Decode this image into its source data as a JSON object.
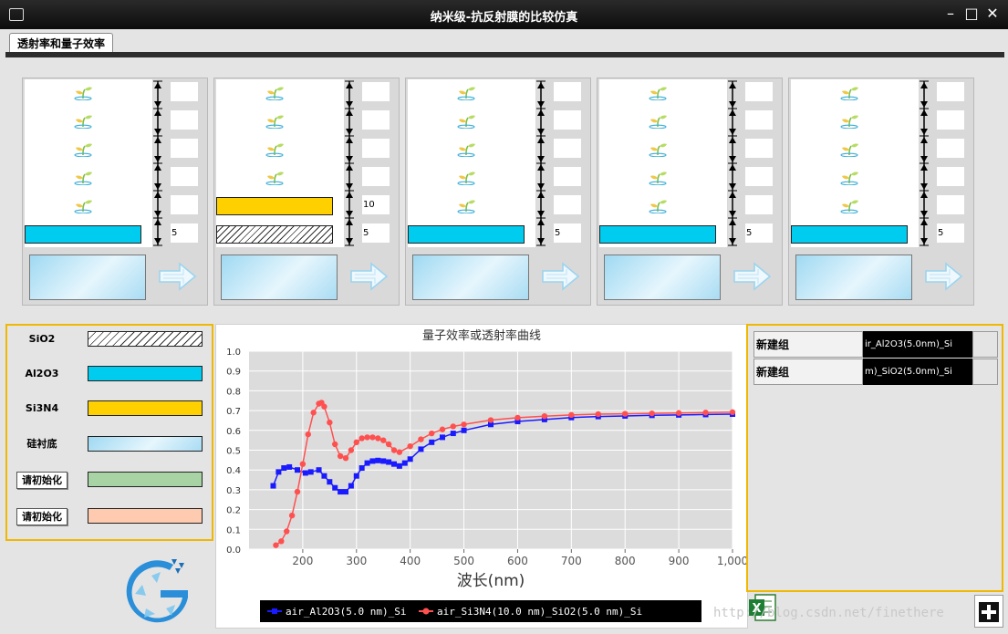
{
  "window": {
    "title": "纳米级-抗反射膜的比较仿真"
  },
  "tabs": [
    {
      "label": "透射率和量子效率"
    }
  ],
  "stacks": [
    {
      "layers": [
        {
          "material": "Al2O3",
          "thickness": "5"
        }
      ]
    },
    {
      "layers": [
        {
          "material": "Si3N4",
          "thickness": "10"
        },
        {
          "material": "SiO2",
          "thickness": "5"
        }
      ]
    },
    {
      "layers": [
        {
          "material": "Al2O3",
          "thickness": "5"
        }
      ]
    },
    {
      "layers": [
        {
          "material": "Al2O3",
          "thickness": "5"
        }
      ]
    },
    {
      "layers": [
        {
          "material": "Al2O3",
          "thickness": "5"
        }
      ]
    }
  ],
  "legend": [
    {
      "label": "SiO2",
      "color": "hatch",
      "kind": "label"
    },
    {
      "label": "Al2O3",
      "color": "#00ccf0",
      "kind": "label"
    },
    {
      "label": "Si3N4",
      "color": "#ffd000",
      "kind": "label"
    },
    {
      "label": "硅衬底",
      "color": "substrate",
      "kind": "label"
    },
    {
      "label": "请初始化",
      "color": "#a8d3a4",
      "kind": "button"
    },
    {
      "label": "请初始化",
      "color": "#ffcbb0",
      "kind": "button"
    }
  ],
  "groups": [
    {
      "name": "新建组",
      "value": "ir_Al2O3(5.0nm)_Si"
    },
    {
      "name": "新建组",
      "value": "m)_SiO2(5.0nm)_Si"
    }
  ],
  "watermark": "http://blog.csdn.net/finethere",
  "chart_data": {
    "type": "scatter",
    "title": "量子效率或透射率曲线",
    "xlabel": "波长(nm)",
    "ylabel": "",
    "xlim": [
      100,
      1000
    ],
    "ylim": [
      0.0,
      1.0
    ],
    "xticks": [
      "200",
      "300",
      "400",
      "500",
      "600",
      "700",
      "800",
      "900",
      "1,000"
    ],
    "yticks": [
      "0.0",
      "0.1",
      "0.2",
      "0.3",
      "0.4",
      "0.5",
      "0.6",
      "0.7",
      "0.8",
      "0.9",
      "1.0"
    ],
    "grid": true,
    "legend_position": "bottom",
    "series": [
      {
        "name": "air_Al2O3(5.0 nm)_Si",
        "color": "#1a1aff",
        "marker": "square",
        "x": [
          145,
          155,
          165,
          175,
          190,
          205,
          215,
          230,
          240,
          250,
          260,
          270,
          280,
          290,
          300,
          310,
          320,
          330,
          340,
          350,
          360,
          370,
          380,
          390,
          400,
          420,
          440,
          460,
          480,
          500,
          550,
          600,
          650,
          700,
          750,
          800,
          850,
          900,
          950,
          1000
        ],
        "y": [
          0.32,
          0.39,
          0.41,
          0.415,
          0.4,
          0.385,
          0.39,
          0.4,
          0.37,
          0.34,
          0.31,
          0.29,
          0.29,
          0.32,
          0.37,
          0.41,
          0.435,
          0.445,
          0.448,
          0.445,
          0.44,
          0.43,
          0.42,
          0.435,
          0.455,
          0.505,
          0.54,
          0.565,
          0.585,
          0.6,
          0.63,
          0.645,
          0.655,
          0.665,
          0.67,
          0.673,
          0.676,
          0.678,
          0.68,
          0.682
        ]
      },
      {
        "name": "air_Si3N4(10.0 nm)_SiO2(5.0 nm)_Si",
        "color": "#ff5050",
        "marker": "circle",
        "x": [
          150,
          160,
          170,
          180,
          190,
          200,
          210,
          220,
          230,
          235,
          240,
          250,
          260,
          270,
          280,
          290,
          300,
          310,
          320,
          330,
          340,
          350,
          360,
          370,
          380,
          400,
          420,
          440,
          460,
          480,
          500,
          550,
          600,
          650,
          700,
          750,
          800,
          850,
          900,
          950,
          1000
        ],
        "y": [
          0.02,
          0.04,
          0.09,
          0.17,
          0.29,
          0.43,
          0.58,
          0.69,
          0.735,
          0.74,
          0.72,
          0.64,
          0.53,
          0.47,
          0.46,
          0.5,
          0.54,
          0.56,
          0.565,
          0.565,
          0.56,
          0.55,
          0.53,
          0.5,
          0.49,
          0.52,
          0.555,
          0.585,
          0.605,
          0.62,
          0.63,
          0.652,
          0.664,
          0.672,
          0.678,
          0.682,
          0.684,
          0.686,
          0.688,
          0.69,
          0.692
        ]
      }
    ]
  }
}
